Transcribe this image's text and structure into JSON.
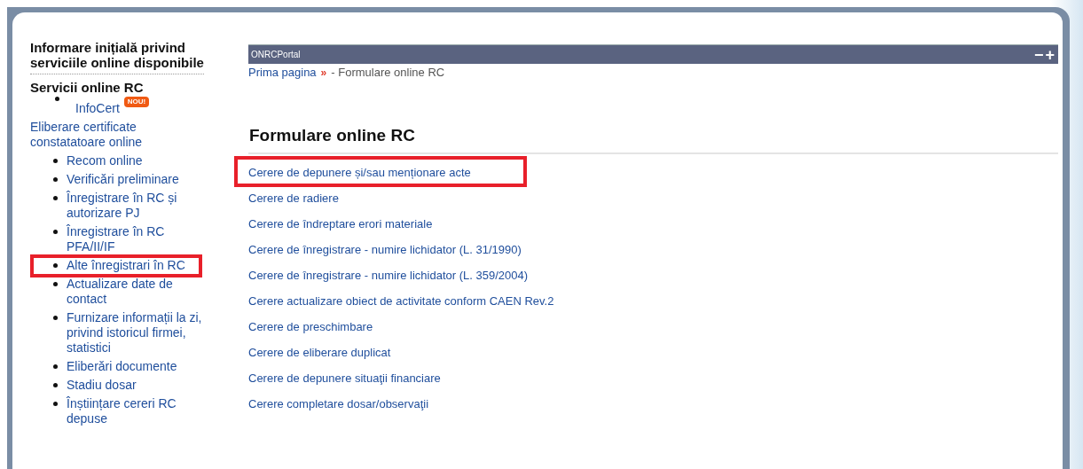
{
  "sidebar": {
    "title": "Informare inițială privind serviciile online disponibile",
    "section": "Servicii online RC",
    "items": [
      {
        "kind": "bullet",
        "label": "InfoCert",
        "badge": "NOU!",
        "highlighted": false
      },
      {
        "kind": "plain",
        "label": "Eliberare certificate constatatoare online",
        "highlighted": false
      },
      {
        "kind": "bullet",
        "label": "Recom online",
        "highlighted": false
      },
      {
        "kind": "bullet",
        "label": "Verificări preliminare",
        "highlighted": false
      },
      {
        "kind": "bullet",
        "label": "Înregistrare în RC și autorizare PJ",
        "highlighted": false
      },
      {
        "kind": "bullet",
        "label": "Înregistrare în RC PFA/II/IF",
        "highlighted": false
      },
      {
        "kind": "bullet",
        "label": "Alte înregistrari în RC",
        "highlighted": true
      },
      {
        "kind": "bullet",
        "label": "Actualizare date de contact",
        "highlighted": false
      },
      {
        "kind": "bullet",
        "label": "Furnizare informații la zi, privind istoricul firmei, statistici",
        "highlighted": false
      },
      {
        "kind": "bullet",
        "label": "Eliberări documente",
        "highlighted": false
      },
      {
        "kind": "bullet",
        "label": "Stadiu dosar",
        "highlighted": false
      },
      {
        "kind": "bullet",
        "label": "Înștiințare cereri RC depuse",
        "highlighted": false
      }
    ]
  },
  "portlet": {
    "title": "ONRCPortal",
    "controls": [
      "−",
      "+"
    ]
  },
  "breadcrumb": {
    "link": "Prima pagina",
    "separator": "»",
    "current": "- Formulare online RC"
  },
  "heading": "Formulare online RC",
  "links": [
    {
      "label": "Cerere de depunere și/sau menționare acte",
      "highlighted": true
    },
    {
      "label": "Cerere de radiere",
      "highlighted": false
    },
    {
      "label": "Cerere de îndreptare erori materiale",
      "highlighted": false
    },
    {
      "label": "Cerere de înregistrare - numire lichidator (L. 31/1990)",
      "highlighted": false
    },
    {
      "label": "Cerere de înregistrare - numire lichidator (L. 359/2004)",
      "highlighted": false
    },
    {
      "label": "Cerere actualizare obiect de activitate conform CAEN Rev.2",
      "highlighted": false
    },
    {
      "label": "Cerere de preschimbare",
      "highlighted": false
    },
    {
      "label": "Cerere de eliberare duplicat",
      "highlighted": false
    },
    {
      "label": "Cerere de depunere situaţii financiare",
      "highlighted": false
    },
    {
      "label": "Cerere completare dosar/observaţii",
      "highlighted": false
    }
  ]
}
